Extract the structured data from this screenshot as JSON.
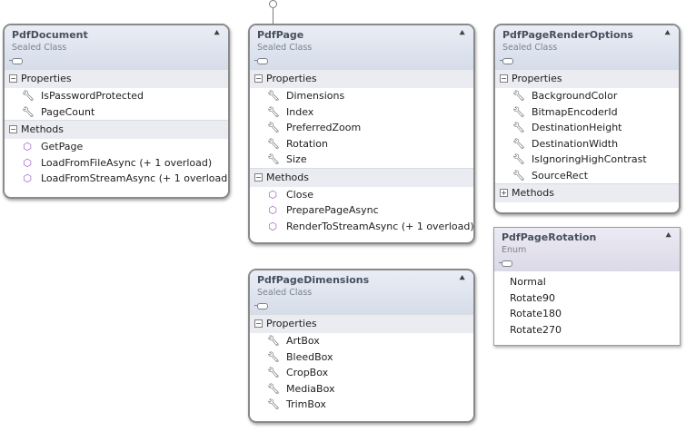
{
  "diagram": {
    "pdf_document": {
      "title": "PdfDocument",
      "kind": "Sealed Class",
      "properties_label": "Properties",
      "properties": [
        "IsPasswordProtected",
        "PageCount"
      ],
      "methods_label": "Methods",
      "methods": [
        "GetPage",
        "LoadFromFileAsync (+ 1 overload)",
        "LoadFromStreamAsync (+ 1 overload)"
      ]
    },
    "pdf_page": {
      "title": "PdfPage",
      "kind": "Sealed Class",
      "properties_label": "Properties",
      "properties": [
        "Dimensions",
        "Index",
        "PreferredZoom",
        "Rotation",
        "Size"
      ],
      "methods_label": "Methods",
      "methods": [
        "Close",
        "PreparePageAsync",
        "RenderToStreamAsync (+ 1 overload)"
      ]
    },
    "pdf_page_render_options": {
      "title": "PdfPageRenderOptions",
      "kind": "Sealed Class",
      "properties_label": "Properties",
      "properties": [
        "BackgroundColor",
        "BitmapEncoderId",
        "DestinationHeight",
        "DestinationWidth",
        "IsIgnoringHighContrast",
        "SourceRect"
      ],
      "methods_label": "Methods"
    },
    "pdf_page_rotation": {
      "title": "PdfPageRotation",
      "kind": "Enum",
      "values": [
        "Normal",
        "Rotate90",
        "Rotate180",
        "Rotate270"
      ]
    },
    "pdf_page_dimensions": {
      "title": "PdfPageDimensions",
      "kind": "Sealed Class",
      "properties_label": "Properties",
      "properties": [
        "ArtBox",
        "BleedBox",
        "CropBox",
        "MediaBox",
        "TrimBox"
      ]
    }
  },
  "icons": {
    "collapse": "double-chevron-up-icon",
    "property": "wrench-icon",
    "method": "cube-icon",
    "class": "class-icon"
  },
  "colors": {
    "header_gradient_top": "#e9edf5",
    "header_gradient_bottom": "#d6dde9",
    "section_bg": "#eaecf1",
    "method_icon": "#9a52c9",
    "title_text": "#46505e"
  }
}
